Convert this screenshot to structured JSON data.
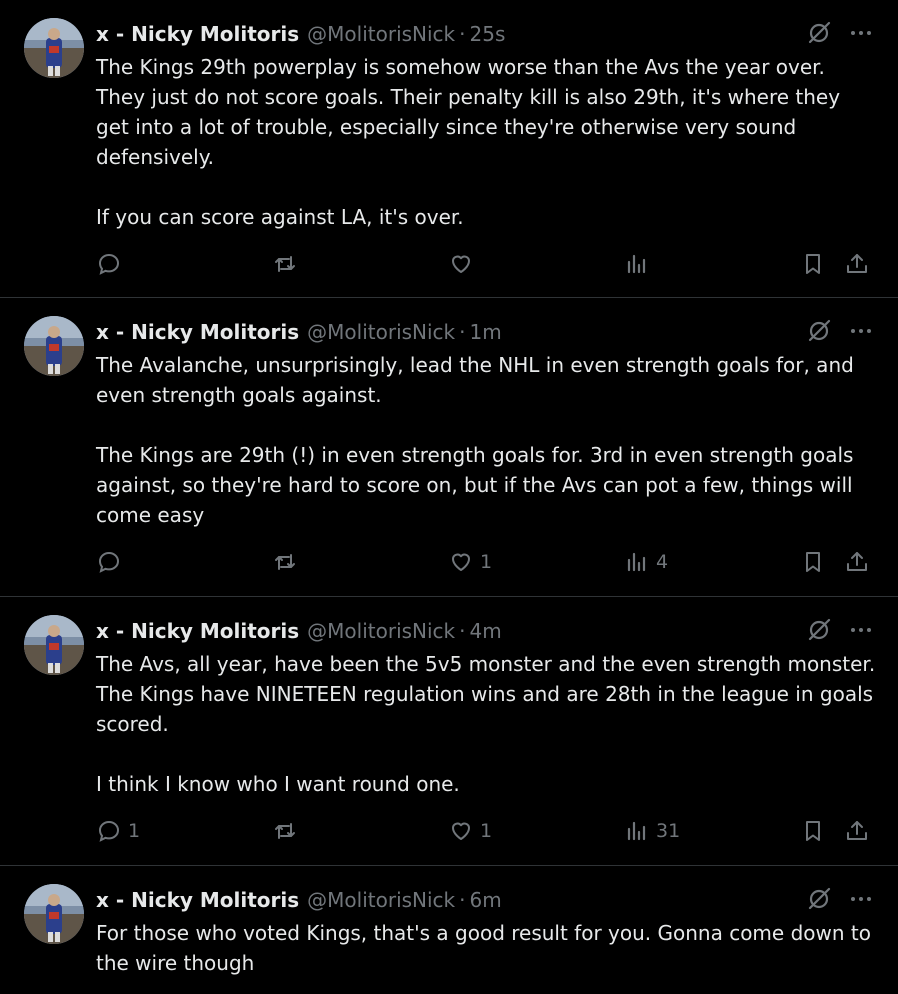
{
  "tweets": [
    {
      "author": "x - Nicky Molitoris",
      "handle": "@MolitorisNick",
      "time": "25s",
      "body": [
        "The Kings 29th powerplay is somehow worse than the Avs the year over. They just do not score goals. Their penalty kill is also 29th, it's where they get into a lot of trouble, especially since they're otherwise very sound defensively.",
        "If you can score against LA, it's over."
      ],
      "replies": "",
      "reposts": "",
      "likes": "",
      "views": ""
    },
    {
      "author": "x - Nicky Molitoris",
      "handle": "@MolitorisNick",
      "time": "1m",
      "body": [
        "The Avalanche, unsurprisingly, lead the NHL in even strength goals for, and even strength goals against.",
        "The Kings are 29th (!) in even strength goals for. 3rd in even strength goals against, so they're hard to score on, but if the Avs can pot a few, things will come easy"
      ],
      "replies": "",
      "reposts": "",
      "likes": "1",
      "views": "4"
    },
    {
      "author": "x - Nicky Molitoris",
      "handle": "@MolitorisNick",
      "time": "4m",
      "body": [
        "The Avs, all year, have been the 5v5 monster and the even strength monster. The Kings have NINETEEN regulation wins and are 28th in the league in goals scored.",
        "I think I know who I want round one."
      ],
      "replies": "1",
      "reposts": "",
      "likes": "1",
      "views": "31"
    },
    {
      "author": "x - Nicky Molitoris",
      "handle": "@MolitorisNick",
      "time": "6m",
      "body": [
        "For those who voted Kings, that's a good result for you. Gonna come down to the wire though"
      ],
      "replies": "",
      "reposts": "",
      "likes": "",
      "views": ""
    }
  ],
  "separator": "·",
  "icons": {
    "grok": "grok-icon",
    "more": "more-icon",
    "reply": "reply-icon",
    "repost": "repost-icon",
    "like": "like-icon",
    "views": "views-icon",
    "bookmark": "bookmark-icon",
    "share": "share-icon"
  },
  "colors": {
    "background": "#000000",
    "text": "#e7e9ea",
    "secondary": "#71767b",
    "divider": "#2f3336"
  }
}
